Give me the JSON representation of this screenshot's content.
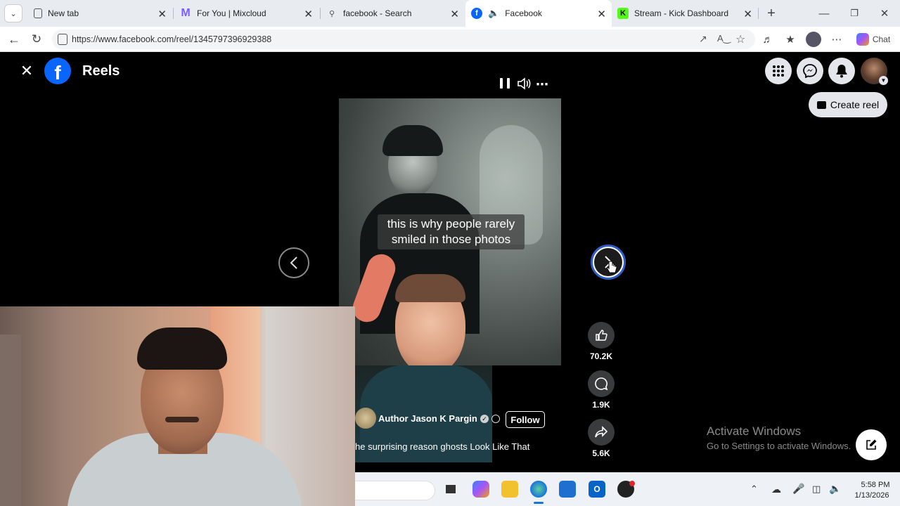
{
  "browser": {
    "tabs": [
      {
        "label": "New tab",
        "icon": "page-icon"
      },
      {
        "label": "For You | Mixcloud",
        "icon": "mixcloud-icon"
      },
      {
        "label": "facebook - Search",
        "icon": "search-icon"
      },
      {
        "label": "Facebook",
        "icon": "facebook-icon",
        "active": true
      },
      {
        "label": "Stream - Kick Dashboard",
        "icon": "kick-icon"
      }
    ],
    "url": "https://www.facebook.com/reel/1345797396929388",
    "chat_label": "Chat"
  },
  "header": {
    "title": "Reels",
    "create_reel_label": "Create reel"
  },
  "reel": {
    "caption_line1": "this is why people rarely",
    "caption_line2": "smiled in those photos",
    "author": "Author Jason K Pargin",
    "follow_label": "Follow",
    "description": "he surprising reason ghosts Look Like That",
    "likes": "70.2K",
    "comments": "1.9K",
    "shares": "5.6K"
  },
  "windows": {
    "watermark_title": "Activate Windows",
    "watermark_sub": "Go to Settings to activate Windows.",
    "time": "5:58 PM",
    "date": "1/13/2026"
  },
  "colors": {
    "facebook_blue": "#0866ff",
    "kick_green": "#53fc18",
    "tab_bar": "#e8ecf1"
  }
}
